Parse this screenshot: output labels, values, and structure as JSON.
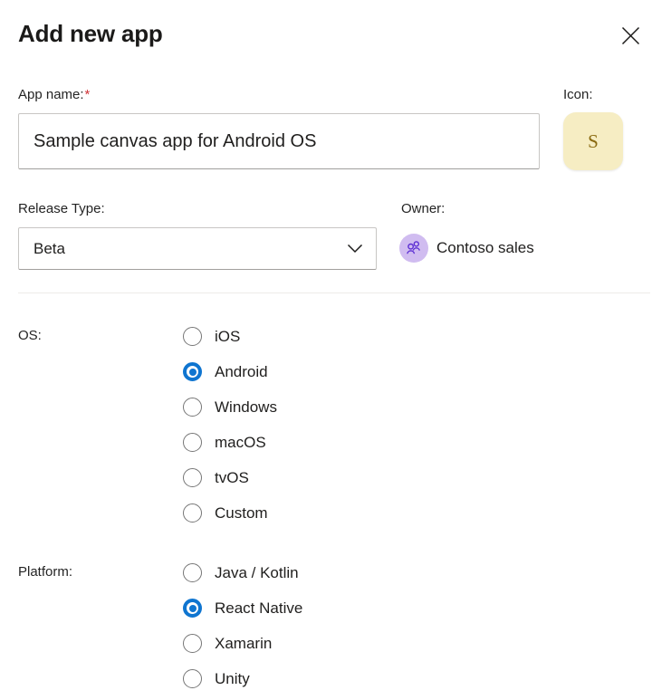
{
  "header": {
    "title": "Add new app",
    "close_icon": "close-icon"
  },
  "app_name": {
    "label": "App name:",
    "required_marker": "*",
    "value": "Sample canvas app for Android OS",
    "placeholder": "App name"
  },
  "icon": {
    "label": "Icon:",
    "initial": "S",
    "tile_color": "#F6EDC3",
    "text_color": "#8A6A10"
  },
  "release_type": {
    "label": "Release Type:",
    "selected": "Beta",
    "chevron_icon": "chevron-down-icon",
    "options": [
      "Beta"
    ]
  },
  "owner": {
    "label": "Owner:",
    "name": "Contoso sales",
    "avatar_icon": "people-icon",
    "avatar_bg": "#D0BCF0",
    "avatar_fg": "#5B2DD3"
  },
  "os": {
    "label": "OS:",
    "selected": "Android",
    "options": [
      {
        "label": "iOS",
        "checked": false
      },
      {
        "label": "Android",
        "checked": true
      },
      {
        "label": "Windows",
        "checked": false
      },
      {
        "label": "macOS",
        "checked": false
      },
      {
        "label": "tvOS",
        "checked": false
      },
      {
        "label": "Custom",
        "checked": false
      }
    ]
  },
  "platform": {
    "label": "Platform:",
    "selected": "React Native",
    "options": [
      {
        "label": "Java / Kotlin",
        "checked": false
      },
      {
        "label": "React Native",
        "checked": true
      },
      {
        "label": "Xamarin",
        "checked": false
      },
      {
        "label": "Unity",
        "checked": false
      }
    ]
  },
  "colors": {
    "accent_blue": "#0F75D0",
    "required_red": "#D13438",
    "divider": "#EDEBE9",
    "border": "#C8C6C4"
  }
}
